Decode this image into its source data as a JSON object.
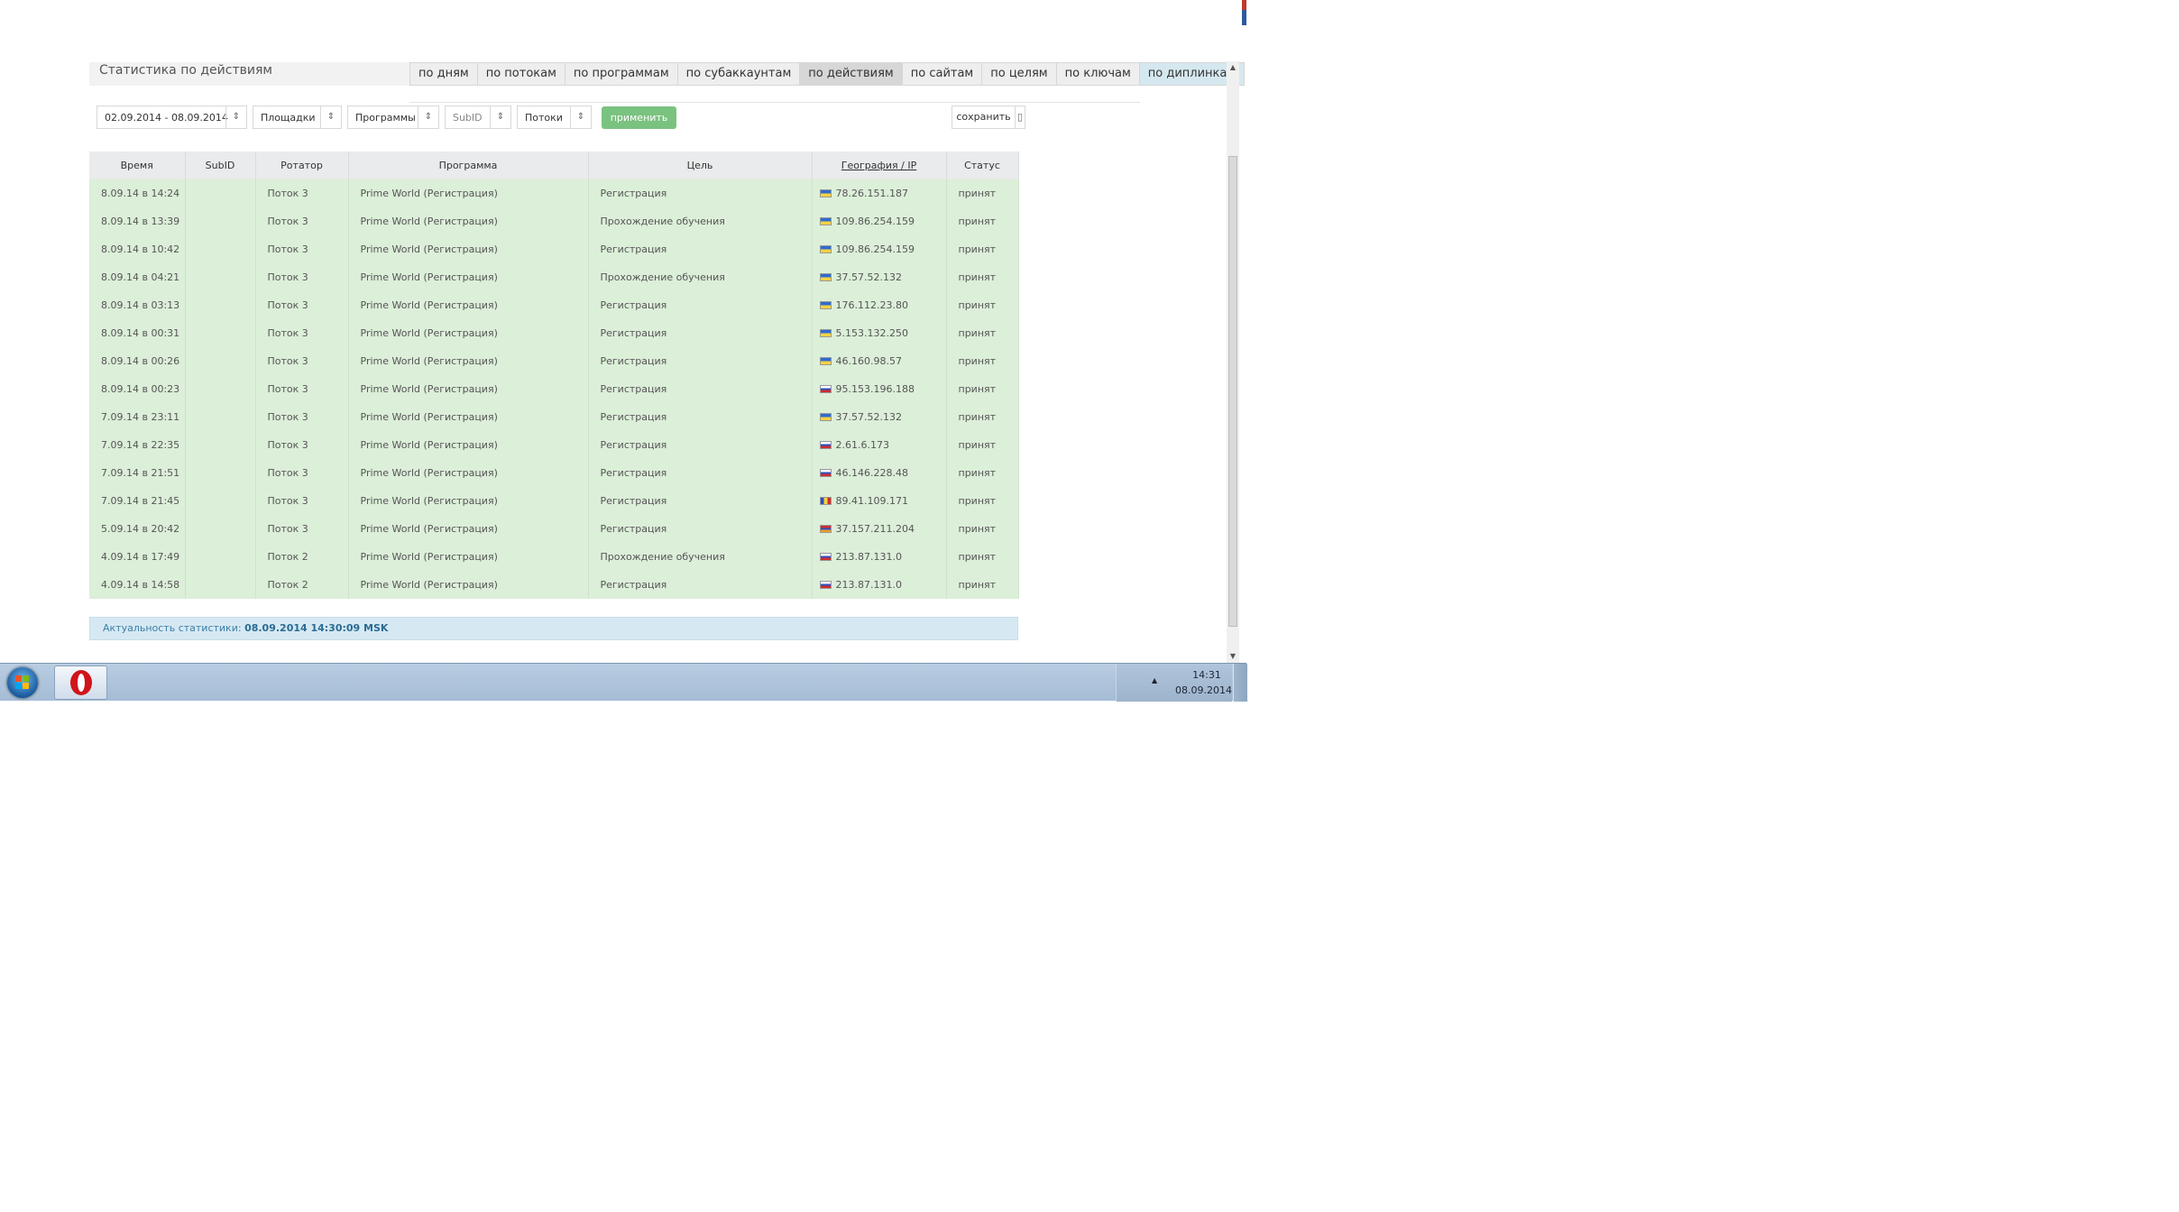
{
  "page": {
    "title": "Статистика по действиям"
  },
  "tabs": [
    {
      "label": "по дням"
    },
    {
      "label": "по потокам"
    },
    {
      "label": "по программам"
    },
    {
      "label": "по субаккаунтам"
    },
    {
      "label": "по действиям"
    },
    {
      "label": "по сайтам"
    },
    {
      "label": "по целям"
    },
    {
      "label": "по ключам"
    },
    {
      "label": "по диплинкам"
    }
  ],
  "active_tab": "по действиям",
  "filters": {
    "date_range": "02.09.2014 - 08.09.2014",
    "sites": "Площадки",
    "programs": "Программы",
    "subid": "SubID",
    "streams": "Потоки",
    "apply_label": "применить",
    "save_label": "сохранить"
  },
  "table": {
    "headers": [
      "Время",
      "SubID",
      "Ротатор",
      "Программа",
      "Цель",
      "География / IP",
      "Статус"
    ],
    "rows": [
      {
        "time": "8.09.14 в 14:24",
        "subid": "",
        "rotator": "Поток 3",
        "program": "Prime World (Регистрация)",
        "goal": "Регистрация",
        "flag": "ua",
        "ip": "78.26.151.187",
        "status": "принят"
      },
      {
        "time": "8.09.14 в 13:39",
        "subid": "",
        "rotator": "Поток 3",
        "program": "Prime World (Регистрация)",
        "goal": "Прохождение обучения",
        "flag": "ua",
        "ip": "109.86.254.159",
        "status": "принят"
      },
      {
        "time": "8.09.14 в 10:42",
        "subid": "",
        "rotator": "Поток 3",
        "program": "Prime World (Регистрация)",
        "goal": "Регистрация",
        "flag": "ua",
        "ip": "109.86.254.159",
        "status": "принят"
      },
      {
        "time": "8.09.14 в 04:21",
        "subid": "",
        "rotator": "Поток 3",
        "program": "Prime World (Регистрация)",
        "goal": "Прохождение обучения",
        "flag": "ua",
        "ip": "37.57.52.132",
        "status": "принят"
      },
      {
        "time": "8.09.14 в 03:13",
        "subid": "",
        "rotator": "Поток 3",
        "program": "Prime World (Регистрация)",
        "goal": "Регистрация",
        "flag": "ua",
        "ip": "176.112.23.80",
        "status": "принят"
      },
      {
        "time": "8.09.14 в 00:31",
        "subid": "",
        "rotator": "Поток 3",
        "program": "Prime World (Регистрация)",
        "goal": "Регистрация",
        "flag": "ua",
        "ip": "5.153.132.250",
        "status": "принят"
      },
      {
        "time": "8.09.14 в 00:26",
        "subid": "",
        "rotator": "Поток 3",
        "program": "Prime World (Регистрация)",
        "goal": "Регистрация",
        "flag": "ua",
        "ip": "46.160.98.57",
        "status": "принят"
      },
      {
        "time": "8.09.14 в 00:23",
        "subid": "",
        "rotator": "Поток 3",
        "program": "Prime World (Регистрация)",
        "goal": "Регистрация",
        "flag": "ru",
        "ip": "95.153.196.188",
        "status": "принят"
      },
      {
        "time": "7.09.14 в 23:11",
        "subid": "",
        "rotator": "Поток 3",
        "program": "Prime World (Регистрация)",
        "goal": "Регистрация",
        "flag": "ua",
        "ip": "37.57.52.132",
        "status": "принят"
      },
      {
        "time": "7.09.14 в 22:35",
        "subid": "",
        "rotator": "Поток 3",
        "program": "Prime World (Регистрация)",
        "goal": "Регистрация",
        "flag": "ru",
        "ip": "2.61.6.173",
        "status": "принят"
      },
      {
        "time": "7.09.14 в 21:51",
        "subid": "",
        "rotator": "Поток 3",
        "program": "Prime World (Регистрация)",
        "goal": "Регистрация",
        "flag": "ru",
        "ip": "46.146.228.48",
        "status": "принят"
      },
      {
        "time": "7.09.14 в 21:45",
        "subid": "",
        "rotator": "Поток 3",
        "program": "Prime World (Регистрация)",
        "goal": "Регистрация",
        "flag": "md",
        "ip": "89.41.109.171",
        "status": "принят"
      },
      {
        "time": "5.09.14 в 20:42",
        "subid": "",
        "rotator": "Поток 3",
        "program": "Prime World (Регистрация)",
        "goal": "Регистрация",
        "flag": "am",
        "ip": "37.157.211.204",
        "status": "принят"
      },
      {
        "time": "4.09.14 в 17:49",
        "subid": "",
        "rotator": "Поток 2",
        "program": "Prime World (Регистрация)",
        "goal": "Прохождение обучения",
        "flag": "ru",
        "ip": "213.87.131.0",
        "status": "принят"
      },
      {
        "time": "4.09.14 в 14:58",
        "subid": "",
        "rotator": "Поток 2",
        "program": "Prime World (Регистрация)",
        "goal": "Регистрация",
        "flag": "ru",
        "ip": "213.87.131.0",
        "status": "принят"
      }
    ]
  },
  "footer": {
    "label": "Актуальность статистики:",
    "value": "08.09.2014 14:30:09 MSK"
  },
  "taskbar": {
    "clock_time": "14:31",
    "clock_date": "08.09.2014",
    "pinned": [
      "windows-start-icon",
      "opera-icon"
    ]
  },
  "colors": {
    "row_bg": "#dcefd9",
    "apply_button": "#7ac280",
    "footer_bg": "#d6e9f3"
  }
}
